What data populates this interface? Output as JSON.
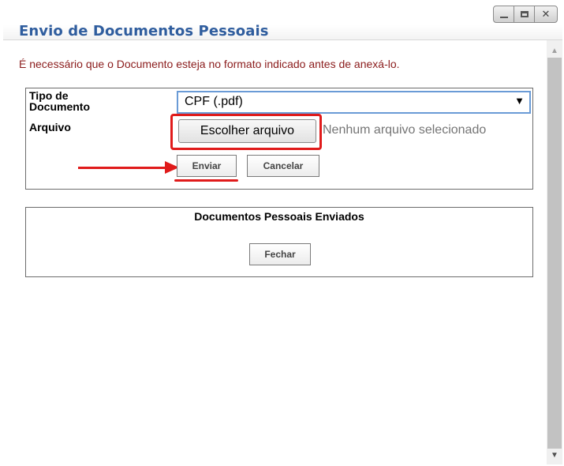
{
  "window": {
    "title": "Envio de Documentos Pessoais",
    "controls": {
      "minimize_icon": "minimize-icon",
      "maximize_icon": "maximize-icon",
      "close_icon": "close-icon"
    }
  },
  "notice": "É necessário que o Documento esteja no formato indicado antes de anexá-lo.",
  "form": {
    "tipo_label": "Tipo de Documento",
    "tipo_label_line1": "Tipo de",
    "tipo_label_line2": "Documento",
    "tipo_value": "CPF (.pdf)",
    "arquivo_label": "Arquivo",
    "file_button": "Escolher arquivo",
    "file_status": "Nenhum arquivo selecionado",
    "submit": "Enviar",
    "cancel": "Cancelar"
  },
  "sent_panel": {
    "title": "Documentos Pessoais Enviados",
    "close": "Fechar"
  },
  "colors": {
    "title": "#2f5d9e",
    "notice": "#8b1c1c",
    "highlight": "#e01b1b",
    "select_border": "#6a9bd6"
  }
}
